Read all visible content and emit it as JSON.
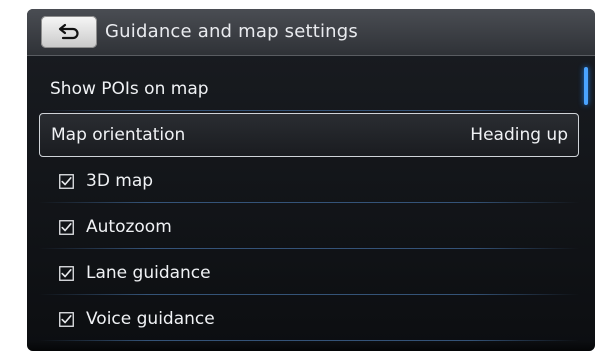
{
  "header": {
    "title": "Guidance and map settings"
  },
  "list": {
    "items": [
      {
        "label": "Show POIs on map"
      },
      {
        "label": "Map orientation",
        "value": "Heading up"
      },
      {
        "label": "3D map",
        "checked": true
      },
      {
        "label": "Autozoom",
        "checked": true
      },
      {
        "label": "Lane guidance",
        "checked": true
      },
      {
        "label": "Voice guidance",
        "checked": true
      }
    ]
  },
  "colors": {
    "accent": "#4aa3ff",
    "text": "#f0f2f5",
    "separator": "#385a82"
  },
  "icons": {
    "back": "back-arrow-icon",
    "check": "checkbox-checked-icon"
  }
}
